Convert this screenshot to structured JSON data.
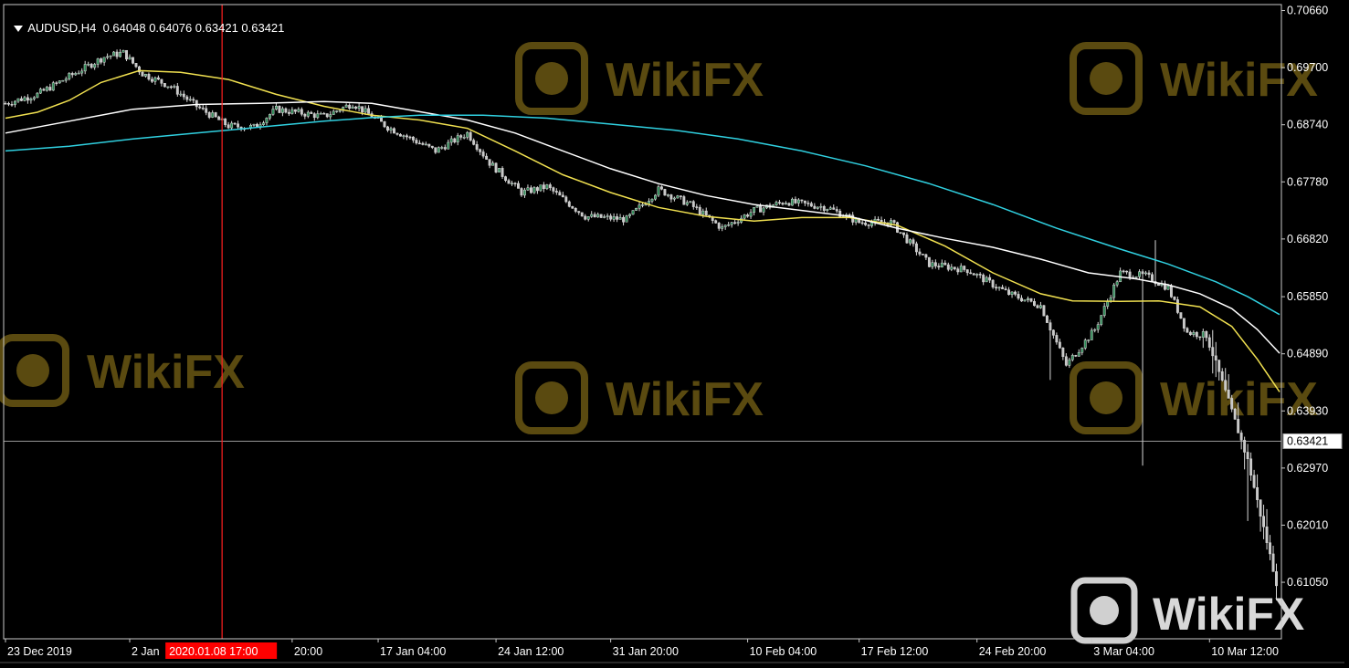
{
  "header": {
    "symbol": "AUDUSD,H4",
    "ohlc": "0.64048 0.64076 0.63421 0.63421"
  },
  "watermark": {
    "text": "WikiFX"
  },
  "current_price_label": "0.63421",
  "crosshair_time_label": "2020.01.08 17:00",
  "colors": {
    "background": "#000000",
    "frame": "#c8c8c8",
    "grid_line": "#c8c8c8",
    "bull_candle": "#2e8b57",
    "bear_candle": "#c8c8c8",
    "ma_fast": "#f0e050",
    "ma_mid": "#ffffff",
    "ma_slow": "#30d0e0",
    "crosshair": "#ff2020",
    "time_label_bg": "#ff0000",
    "watermark": "#5a4a10"
  },
  "chart_data": {
    "type": "candlestick",
    "instrument": "AUDUSD",
    "timeframe": "H4",
    "ylim": [
      0.601,
      0.7076
    ],
    "y_ticks": [
      "0.70660",
      "0.69700",
      "0.68740",
      "0.67780",
      "0.66820",
      "0.65850",
      "0.64890",
      "0.63930",
      "0.62970",
      "0.62010",
      "0.61050"
    ],
    "x_ticks": [
      "23 Dec 2019",
      "2 Jan",
      "20:00",
      "17 Jan 04:00",
      "24 Jan 12:00",
      "31 Jan 20:00",
      "10 Feb 04:00",
      "17 Feb 12:00",
      "24 Feb 20:00",
      "3 Mar 04:00",
      "10 Mar 12:00"
    ],
    "x_tick_bar_index": [
      0,
      39,
      90,
      117,
      154,
      190,
      233,
      268,
      305,
      341,
      378
    ],
    "bar_count": 400,
    "current_price": 0.63421,
    "crosshair_bar_index": 68,
    "price_path": [
      [
        0,
        0.691
      ],
      [
        10,
        0.6925
      ],
      [
        20,
        0.6955
      ],
      [
        31,
        0.6988
      ],
      [
        37,
        0.6995
      ],
      [
        43,
        0.696
      ],
      [
        52,
        0.6938
      ],
      [
        60,
        0.6905
      ],
      [
        70,
        0.6872
      ],
      [
        78,
        0.687
      ],
      [
        85,
        0.69
      ],
      [
        100,
        0.6888
      ],
      [
        109,
        0.691
      ],
      [
        120,
        0.687
      ],
      [
        135,
        0.683
      ],
      [
        145,
        0.686
      ],
      [
        152,
        0.681
      ],
      [
        162,
        0.676
      ],
      [
        170,
        0.677
      ],
      [
        182,
        0.672
      ],
      [
        195,
        0.6715
      ],
      [
        205,
        0.6765
      ],
      [
        215,
        0.674
      ],
      [
        225,
        0.67
      ],
      [
        235,
        0.673
      ],
      [
        245,
        0.6745
      ],
      [
        258,
        0.6735
      ],
      [
        268,
        0.671
      ],
      [
        278,
        0.671
      ],
      [
        290,
        0.664
      ],
      [
        302,
        0.663
      ],
      [
        315,
        0.659
      ],
      [
        325,
        0.657
      ],
      [
        333,
        0.647
      ],
      [
        342,
        0.653
      ],
      [
        350,
        0.6625
      ],
      [
        358,
        0.662
      ],
      [
        365,
        0.66
      ],
      [
        371,
        0.6525
      ],
      [
        377,
        0.652
      ],
      [
        383,
        0.6425
      ],
      [
        390,
        0.631
      ],
      [
        400,
        0.6082
      ]
    ],
    "spikes": [
      {
        "bar": 328,
        "low": 0.6445
      },
      {
        "bar": 357,
        "low": 0.6301
      },
      {
        "bar": 361,
        "high": 0.668
      },
      {
        "bar": 390,
        "low": 0.6208
      }
    ],
    "moving_averages": [
      {
        "color_key": "ma_fast",
        "values": [
          [
            0,
            0.6885
          ],
          [
            10,
            0.6895
          ],
          [
            20,
            0.6915
          ],
          [
            30,
            0.6945
          ],
          [
            42,
            0.6965
          ],
          [
            55,
            0.6962
          ],
          [
            70,
            0.695
          ],
          [
            85,
            0.6925
          ],
          [
            100,
            0.6905
          ],
          [
            115,
            0.689
          ],
          [
            130,
            0.6882
          ],
          [
            145,
            0.6868
          ],
          [
            160,
            0.683
          ],
          [
            175,
            0.679
          ],
          [
            190,
            0.676
          ],
          [
            205,
            0.6735
          ],
          [
            220,
            0.672
          ],
          [
            235,
            0.6712
          ],
          [
            250,
            0.6718
          ],
          [
            265,
            0.6718
          ],
          [
            280,
            0.6705
          ],
          [
            295,
            0.667
          ],
          [
            310,
            0.6625
          ],
          [
            325,
            0.659
          ],
          [
            335,
            0.6578
          ],
          [
            350,
            0.6577
          ],
          [
            362,
            0.6578
          ],
          [
            375,
            0.6568
          ],
          [
            385,
            0.6535
          ],
          [
            393,
            0.648
          ],
          [
            400,
            0.6425
          ]
        ]
      },
      {
        "color_key": "ma_mid",
        "values": [
          [
            0,
            0.686
          ],
          [
            20,
            0.688
          ],
          [
            40,
            0.69
          ],
          [
            60,
            0.6908
          ],
          [
            80,
            0.691
          ],
          [
            100,
            0.6913
          ],
          [
            115,
            0.691
          ],
          [
            130,
            0.6896
          ],
          [
            145,
            0.6882
          ],
          [
            160,
            0.686
          ],
          [
            175,
            0.683
          ],
          [
            190,
            0.68
          ],
          [
            205,
            0.6775
          ],
          [
            220,
            0.6755
          ],
          [
            235,
            0.674
          ],
          [
            250,
            0.673
          ],
          [
            265,
            0.672
          ],
          [
            280,
            0.67
          ],
          [
            295,
            0.6683
          ],
          [
            310,
            0.6668
          ],
          [
            325,
            0.6648
          ],
          [
            340,
            0.6625
          ],
          [
            355,
            0.6615
          ],
          [
            365,
            0.6605
          ],
          [
            375,
            0.659
          ],
          [
            385,
            0.6565
          ],
          [
            393,
            0.653
          ],
          [
            400,
            0.649
          ]
        ]
      },
      {
        "color_key": "ma_slow",
        "values": [
          [
            0,
            0.683
          ],
          [
            20,
            0.6838
          ],
          [
            40,
            0.685
          ],
          [
            60,
            0.686
          ],
          [
            80,
            0.687
          ],
          [
            100,
            0.688
          ],
          [
            115,
            0.6886
          ],
          [
            130,
            0.689
          ],
          [
            150,
            0.689
          ],
          [
            170,
            0.6885
          ],
          [
            190,
            0.6875
          ],
          [
            210,
            0.6865
          ],
          [
            230,
            0.685
          ],
          [
            250,
            0.683
          ],
          [
            270,
            0.6805
          ],
          [
            290,
            0.6775
          ],
          [
            310,
            0.674
          ],
          [
            330,
            0.67
          ],
          [
            350,
            0.6665
          ],
          [
            365,
            0.664
          ],
          [
            380,
            0.661
          ],
          [
            390,
            0.6585
          ],
          [
            400,
            0.6555
          ]
        ]
      }
    ]
  }
}
